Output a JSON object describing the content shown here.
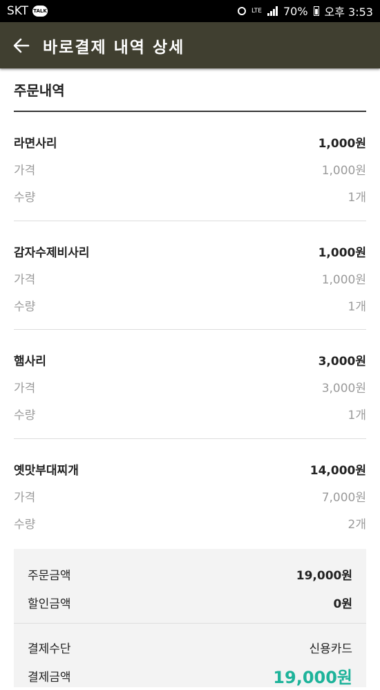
{
  "status": {
    "carrier": "SKT",
    "talk_badge": "TALK",
    "network": "LTE",
    "battery": "70%",
    "time": "오후 3:53"
  },
  "appbar": {
    "back_icon": "arrow-left-icon",
    "title": "바로결제 내역 상세"
  },
  "order": {
    "section_title": "주문내역",
    "items": [
      {
        "name": "라면사리",
        "total": "1,000원",
        "price_label": "가격",
        "price": "1,000원",
        "qty_label": "수량",
        "qty": "1개"
      },
      {
        "name": "감자수제비사리",
        "total": "1,000원",
        "price_label": "가격",
        "price": "1,000원",
        "qty_label": "수량",
        "qty": "1개"
      },
      {
        "name": "햄사리",
        "total": "3,000원",
        "price_label": "가격",
        "price": "3,000원",
        "qty_label": "수량",
        "qty": "1개"
      },
      {
        "name": "옛맛부대찌개",
        "total": "14,000원",
        "price_label": "가격",
        "price": "7,000원",
        "qty_label": "수량",
        "qty": "2개"
      }
    ]
  },
  "summary": {
    "order_amount_label": "주문금액",
    "order_amount": "19,000원",
    "discount_label": "할인금액",
    "discount": "0원",
    "method_label": "결제수단",
    "method": "신용카드",
    "paid_label": "결제금액",
    "paid": "19,000원",
    "accent_color": "#1db39a"
  }
}
